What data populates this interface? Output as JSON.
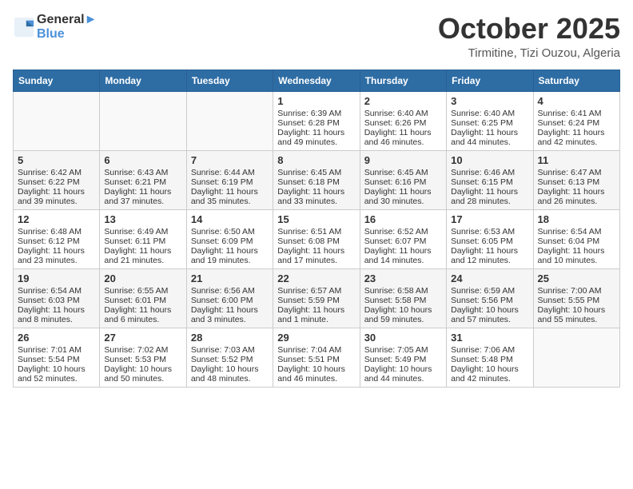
{
  "header": {
    "logo_line1": "General",
    "logo_line2": "Blue",
    "month": "October 2025",
    "location": "Tirmitine, Tizi Ouzou, Algeria"
  },
  "weekdays": [
    "Sunday",
    "Monday",
    "Tuesday",
    "Wednesday",
    "Thursday",
    "Friday",
    "Saturday"
  ],
  "weeks": [
    [
      {
        "day": "",
        "text": ""
      },
      {
        "day": "",
        "text": ""
      },
      {
        "day": "",
        "text": ""
      },
      {
        "day": "1",
        "text": "Sunrise: 6:39 AM\nSunset: 6:28 PM\nDaylight: 11 hours and 49 minutes."
      },
      {
        "day": "2",
        "text": "Sunrise: 6:40 AM\nSunset: 6:26 PM\nDaylight: 11 hours and 46 minutes."
      },
      {
        "day": "3",
        "text": "Sunrise: 6:40 AM\nSunset: 6:25 PM\nDaylight: 11 hours and 44 minutes."
      },
      {
        "day": "4",
        "text": "Sunrise: 6:41 AM\nSunset: 6:24 PM\nDaylight: 11 hours and 42 minutes."
      }
    ],
    [
      {
        "day": "5",
        "text": "Sunrise: 6:42 AM\nSunset: 6:22 PM\nDaylight: 11 hours and 39 minutes."
      },
      {
        "day": "6",
        "text": "Sunrise: 6:43 AM\nSunset: 6:21 PM\nDaylight: 11 hours and 37 minutes."
      },
      {
        "day": "7",
        "text": "Sunrise: 6:44 AM\nSunset: 6:19 PM\nDaylight: 11 hours and 35 minutes."
      },
      {
        "day": "8",
        "text": "Sunrise: 6:45 AM\nSunset: 6:18 PM\nDaylight: 11 hours and 33 minutes."
      },
      {
        "day": "9",
        "text": "Sunrise: 6:45 AM\nSunset: 6:16 PM\nDaylight: 11 hours and 30 minutes."
      },
      {
        "day": "10",
        "text": "Sunrise: 6:46 AM\nSunset: 6:15 PM\nDaylight: 11 hours and 28 minutes."
      },
      {
        "day": "11",
        "text": "Sunrise: 6:47 AM\nSunset: 6:13 PM\nDaylight: 11 hours and 26 minutes."
      }
    ],
    [
      {
        "day": "12",
        "text": "Sunrise: 6:48 AM\nSunset: 6:12 PM\nDaylight: 11 hours and 23 minutes."
      },
      {
        "day": "13",
        "text": "Sunrise: 6:49 AM\nSunset: 6:11 PM\nDaylight: 11 hours and 21 minutes."
      },
      {
        "day": "14",
        "text": "Sunrise: 6:50 AM\nSunset: 6:09 PM\nDaylight: 11 hours and 19 minutes."
      },
      {
        "day": "15",
        "text": "Sunrise: 6:51 AM\nSunset: 6:08 PM\nDaylight: 11 hours and 17 minutes."
      },
      {
        "day": "16",
        "text": "Sunrise: 6:52 AM\nSunset: 6:07 PM\nDaylight: 11 hours and 14 minutes."
      },
      {
        "day": "17",
        "text": "Sunrise: 6:53 AM\nSunset: 6:05 PM\nDaylight: 11 hours and 12 minutes."
      },
      {
        "day": "18",
        "text": "Sunrise: 6:54 AM\nSunset: 6:04 PM\nDaylight: 11 hours and 10 minutes."
      }
    ],
    [
      {
        "day": "19",
        "text": "Sunrise: 6:54 AM\nSunset: 6:03 PM\nDaylight: 11 hours and 8 minutes."
      },
      {
        "day": "20",
        "text": "Sunrise: 6:55 AM\nSunset: 6:01 PM\nDaylight: 11 hours and 6 minutes."
      },
      {
        "day": "21",
        "text": "Sunrise: 6:56 AM\nSunset: 6:00 PM\nDaylight: 11 hours and 3 minutes."
      },
      {
        "day": "22",
        "text": "Sunrise: 6:57 AM\nSunset: 5:59 PM\nDaylight: 11 hours and 1 minute."
      },
      {
        "day": "23",
        "text": "Sunrise: 6:58 AM\nSunset: 5:58 PM\nDaylight: 10 hours and 59 minutes."
      },
      {
        "day": "24",
        "text": "Sunrise: 6:59 AM\nSunset: 5:56 PM\nDaylight: 10 hours and 57 minutes."
      },
      {
        "day": "25",
        "text": "Sunrise: 7:00 AM\nSunset: 5:55 PM\nDaylight: 10 hours and 55 minutes."
      }
    ],
    [
      {
        "day": "26",
        "text": "Sunrise: 7:01 AM\nSunset: 5:54 PM\nDaylight: 10 hours and 52 minutes."
      },
      {
        "day": "27",
        "text": "Sunrise: 7:02 AM\nSunset: 5:53 PM\nDaylight: 10 hours and 50 minutes."
      },
      {
        "day": "28",
        "text": "Sunrise: 7:03 AM\nSunset: 5:52 PM\nDaylight: 10 hours and 48 minutes."
      },
      {
        "day": "29",
        "text": "Sunrise: 7:04 AM\nSunset: 5:51 PM\nDaylight: 10 hours and 46 minutes."
      },
      {
        "day": "30",
        "text": "Sunrise: 7:05 AM\nSunset: 5:49 PM\nDaylight: 10 hours and 44 minutes."
      },
      {
        "day": "31",
        "text": "Sunrise: 7:06 AM\nSunset: 5:48 PM\nDaylight: 10 hours and 42 minutes."
      },
      {
        "day": "",
        "text": ""
      }
    ]
  ]
}
